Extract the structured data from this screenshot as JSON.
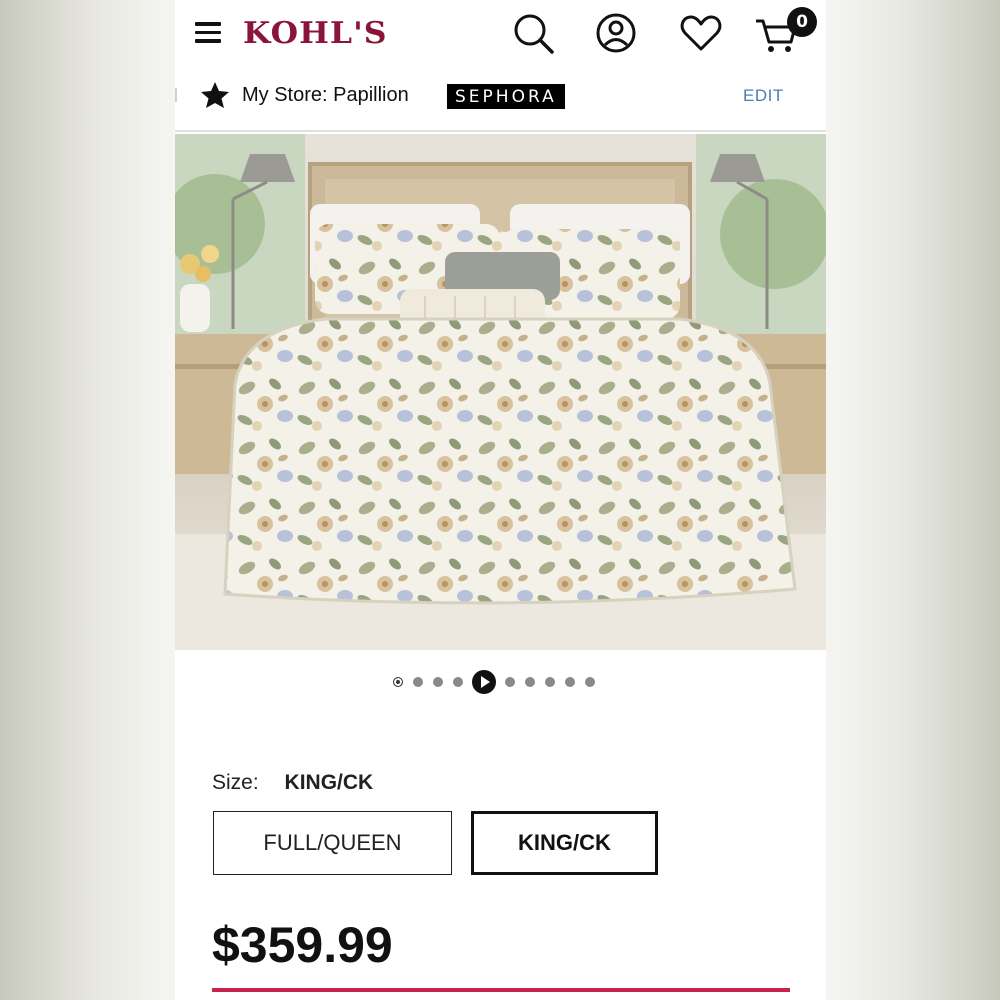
{
  "header": {
    "brand": "KOHL'S",
    "cart_count": "0",
    "icons": [
      "menu-icon",
      "search-icon",
      "account-icon",
      "heart-icon",
      "cart-icon"
    ]
  },
  "store_bar": {
    "store_label": "My Store: Papillion",
    "partner": "SEPHORA",
    "edit_label": "EDIT"
  },
  "carousel": {
    "total_slides": 10,
    "active_index": 4
  },
  "size": {
    "label": "Size:",
    "selected": "KING/CK",
    "options": [
      "FULL/QUEEN",
      "KING/CK"
    ]
  },
  "price": "$359.99",
  "colors": {
    "brand": "#8a1538",
    "link": "#4a7db5",
    "accent_rule": "#c8234a"
  }
}
